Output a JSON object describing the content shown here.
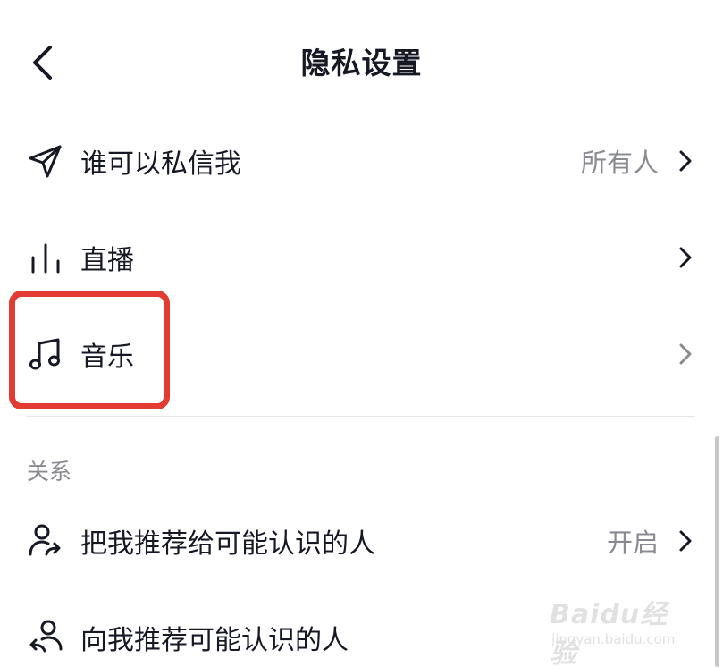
{
  "header": {
    "title": "隐私设置",
    "back_icon": "chevron-left-icon"
  },
  "rows": [
    {
      "label": "谁可以私信我",
      "value": "所有人",
      "icon": "paper-plane-icon"
    },
    {
      "label": "直播",
      "value": "",
      "icon": "live-bars-icon"
    },
    {
      "label": "音乐",
      "value": "",
      "icon": "music-note-icon"
    }
  ],
  "section": {
    "title": "关系",
    "rows": [
      {
        "label": "把我推荐给可能认识的人",
        "value": "开启",
        "icon": "user-share-icon"
      },
      {
        "label": "向我推荐可能认识的人",
        "value": "",
        "icon": "user-recommend-icon"
      }
    ]
  },
  "highlight_color": "#e33a32",
  "watermark": {
    "brand": "Baidu经验",
    "url": "jingyan.baidu.com"
  }
}
